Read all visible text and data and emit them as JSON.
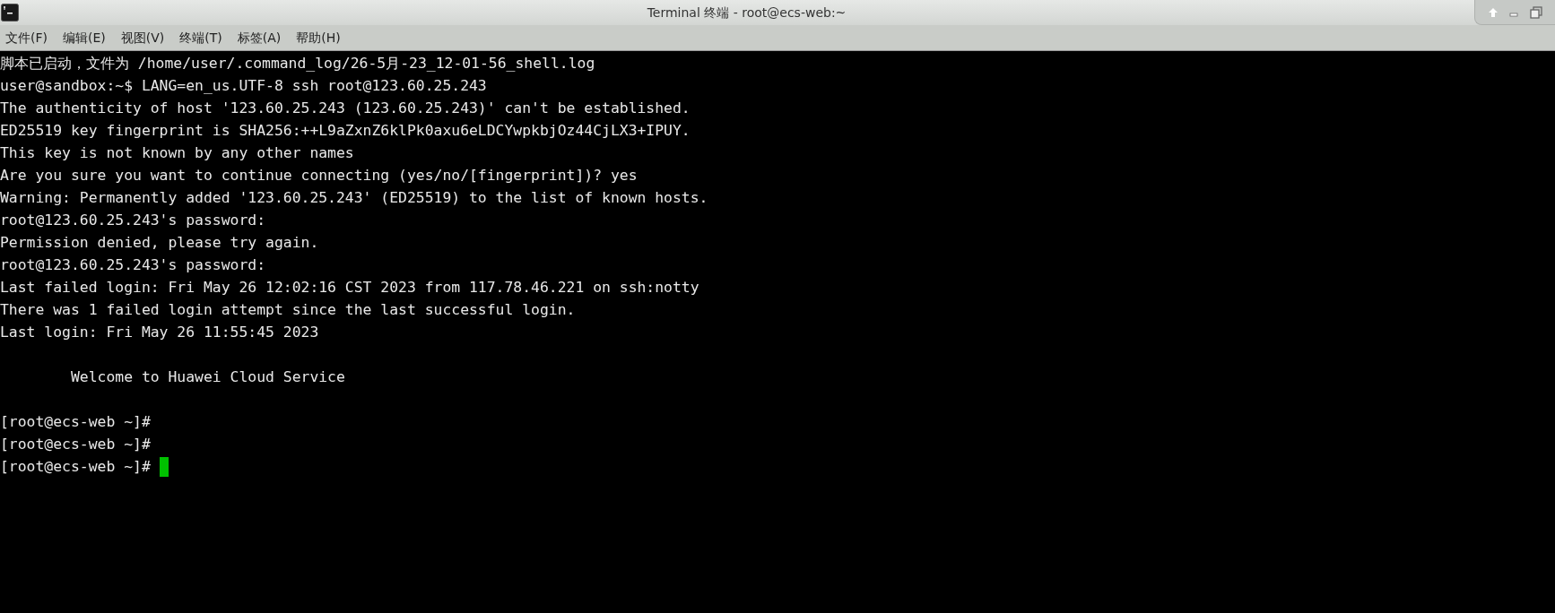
{
  "window": {
    "title": "Terminal 终端 - root@ecs-web:~"
  },
  "menu": [
    "文件(F)",
    "编辑(E)",
    "视图(V)",
    "终端(T)",
    "标签(A)",
    "帮助(H)"
  ],
  "terminal": {
    "lines": [
      {
        "kind": "text",
        "text": "脚本已启动，文件为 /home/user/.command_log/26-5月-23_12-01-56_shell.log"
      },
      {
        "kind": "text",
        "text": "user@sandbox:~$ LANG=en_us.UTF-8 ssh root@123.60.25.243"
      },
      {
        "kind": "text",
        "text": "The authenticity of host '123.60.25.243 (123.60.25.243)' can't be established."
      },
      {
        "kind": "text",
        "text": "ED25519 key fingerprint is SHA256:++L9aZxnZ6klPk0axu6eLDCYwpkbjOz44CjLX3+IPUY."
      },
      {
        "kind": "text",
        "text": "This key is not known by any other names"
      },
      {
        "kind": "text",
        "text": "Are you sure you want to continue connecting (yes/no/[fingerprint])? yes"
      },
      {
        "kind": "text",
        "text": "Warning: Permanently added '123.60.25.243' (ED25519) to the list of known hosts."
      },
      {
        "kind": "text",
        "text": "root@123.60.25.243's password:"
      },
      {
        "kind": "text",
        "text": "Permission denied, please try again."
      },
      {
        "kind": "text",
        "text": "root@123.60.25.243's password:"
      },
      {
        "kind": "text",
        "text": "Last failed login: Fri May 26 12:02:16 CST 2023 from 117.78.46.221 on ssh:notty"
      },
      {
        "kind": "text",
        "text": "There was 1 failed login attempt since the last successful login."
      },
      {
        "kind": "text",
        "text": "Last login: Fri May 26 11:55:45 2023"
      },
      {
        "kind": "blank"
      },
      {
        "kind": "text",
        "text": "        Welcome to Huawei Cloud Service"
      },
      {
        "kind": "blank"
      },
      {
        "kind": "text",
        "text": "[root@ecs-web ~]#"
      },
      {
        "kind": "text",
        "text": "[root@ecs-web ~]#"
      },
      {
        "kind": "prompt",
        "text": "[root@ecs-web ~]#",
        "cursor": true
      }
    ]
  }
}
